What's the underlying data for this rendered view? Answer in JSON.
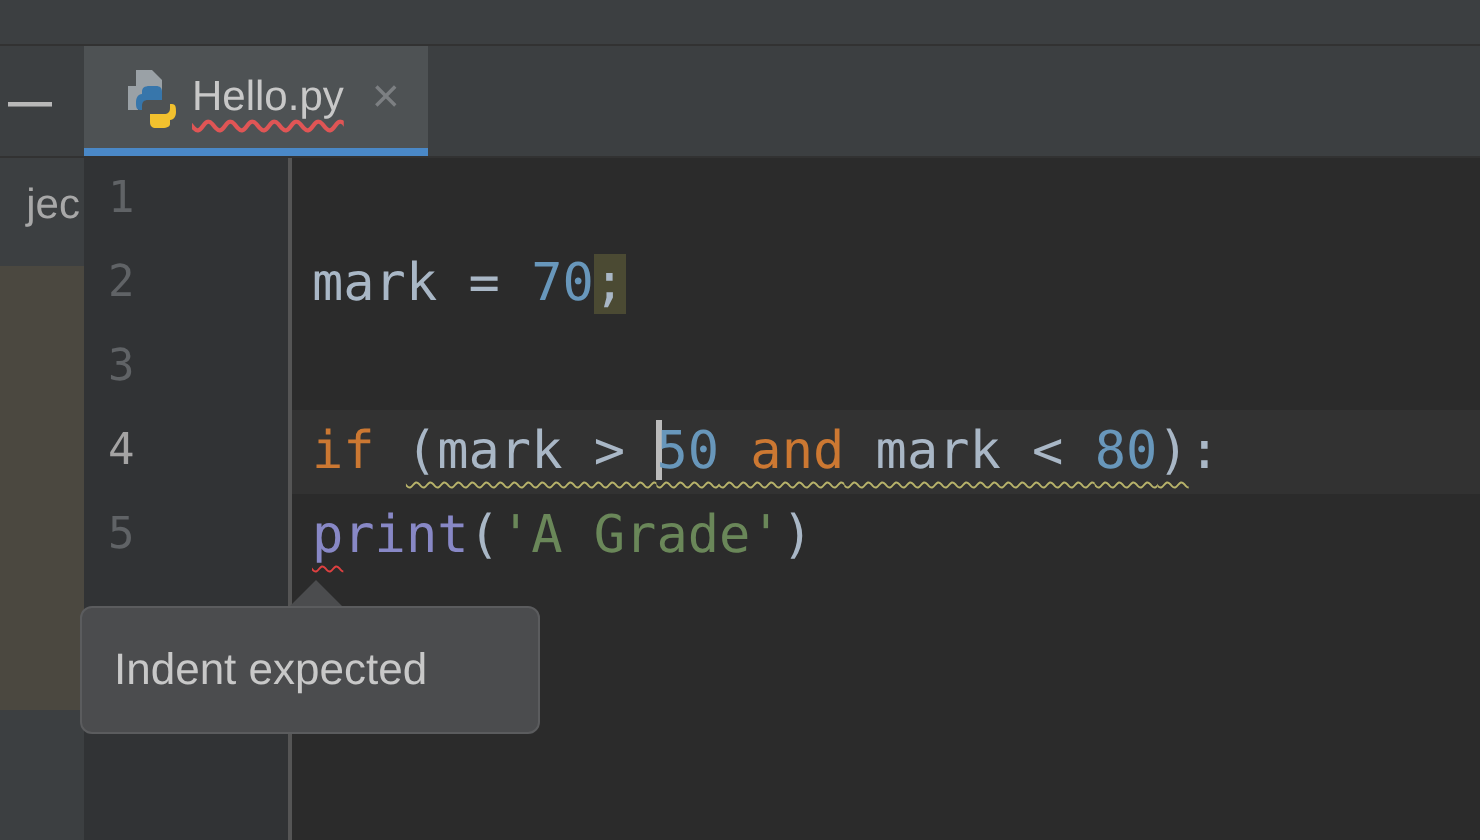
{
  "side_panel": {
    "tab_label": "—",
    "title": "jec"
  },
  "tabs": [
    {
      "label": "Hello.py",
      "selected": true,
      "spelling_error": true,
      "close": "×"
    }
  ],
  "editor": {
    "lines": [
      {
        "number": "1",
        "current": false
      },
      {
        "number": "2",
        "current": false,
        "tokens": [
          {
            "text": "mark = ",
            "kind": "plain"
          },
          {
            "text": "70",
            "kind": "number"
          },
          {
            "text": ";",
            "kind": "plain",
            "highlight": true
          }
        ]
      },
      {
        "number": "3",
        "current": false
      },
      {
        "number": "4",
        "current": true,
        "tokens": [
          {
            "text": "if ",
            "kind": "keyword"
          },
          {
            "text": "(mark > ",
            "kind": "plain",
            "warning": true
          },
          {
            "text": "50",
            "kind": "number",
            "warning": true,
            "caret": true
          },
          {
            "text": " and",
            "kind": "keyword",
            "warning": true
          },
          {
            "text": " mark < ",
            "kind": "plain",
            "warning": true
          },
          {
            "text": "80",
            "kind": "number",
            "warning": true
          },
          {
            "text": ")",
            "kind": "plain",
            "warning": true
          },
          {
            "text": ":",
            "kind": "plain"
          }
        ]
      },
      {
        "number": "5",
        "current": false,
        "tokens": [
          {
            "text": "p",
            "kind": "builtin",
            "error": true
          },
          {
            "text": "rint",
            "kind": "builtin"
          },
          {
            "text": "(",
            "kind": "plain"
          },
          {
            "text": "'A Grade'",
            "kind": "string"
          },
          {
            "text": ")",
            "kind": "plain"
          }
        ]
      }
    ]
  },
  "tooltip": {
    "text": "Indent expected"
  }
}
